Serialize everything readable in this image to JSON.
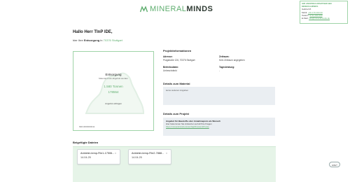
{
  "brand": {
    "part1": "MINERAL",
    "part2": "MINDS",
    "accent": "#5fae6f"
  },
  "contact": {
    "title": "IHR ANSPRECHPARTNER BEI MINERALMINDS",
    "name": "Gabriel M.",
    "phone_label": "Mobil:",
    "phone": "+49 176 000 00",
    "fax_label": "Telefon:",
    "fax": "0711 000 000",
    "email_label": "E-Mail:",
    "email": "info@mineralminds.de"
  },
  "greeting": "Hallo Herr TInP IDE,",
  "subline": {
    "prefix": "hier Ihre",
    "bold": "Entsorgung",
    "mid": "in",
    "location": "70376 Stuttgart"
  },
  "disposal": {
    "title": "Entsorgung",
    "subtitle": "Material muss abgeholt werden",
    "quantity": "1.580 Tonnen",
    "id": "178554",
    "link": "Angebot anfragen",
    "reference": "MM-0000000011"
  },
  "project_info": {
    "heading": "Projektinformationen",
    "address_label": "Adresse:",
    "address_value": "Pragstraße 126, 70376 Stuttgart",
    "timeframe_label": "Zeitraum:",
    "timeframe_value": "Kein Zeitraum angegeben",
    "operator_label": "Betriebsdaten:",
    "operator_value": "Unbeschränkt",
    "daily_label": "Tagesleistung:",
    "daily_value": "-"
  },
  "material": {
    "heading": "Details zum Material",
    "text": "keine weiteren Angaben"
  },
  "project": {
    "heading": "Details zum Projekt",
    "bold": "Angebot für Baustoffe oder Annahmepreis als Wunsch",
    "line2": "Hier bekommen Sie Antworten auf all Ihre Fragen",
    "link": "https://mineralminds.de/en/faq#Kosten&Preise"
  },
  "files": {
    "heading": "Beigefügte Dateien",
    "items": [
      {
        "name": "Anbieter-temp-File1-17506...",
        "date": "14.04.25"
      },
      {
        "name": "Anbieter-temp-File2-7888...",
        "date": "14.04.25"
      }
    ]
  },
  "help_label": "Hilfe?"
}
